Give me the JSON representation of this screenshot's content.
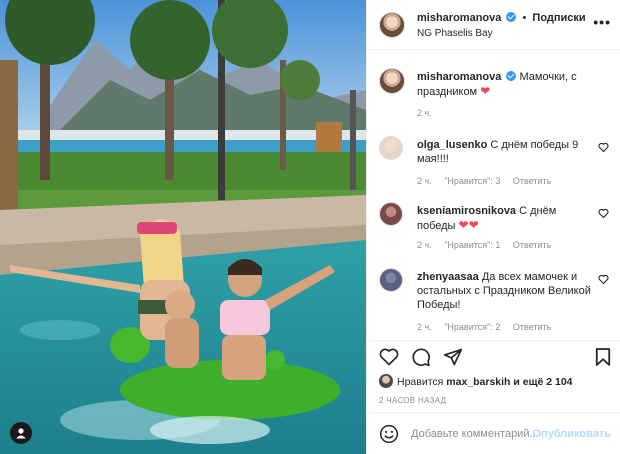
{
  "header": {
    "username": "misharomanova",
    "follow_label": "Подписки",
    "location": "NG Phaselis Bay",
    "more_label": "•••"
  },
  "caption": {
    "username": "misharomanova",
    "text": "Мамочки, с праздником",
    "time": "2 ч."
  },
  "comments": [
    {
      "username": "olga_lusenko",
      "text": "С днём победы 9 мая!!!!",
      "time": "2 ч.",
      "likes": "\"Нравится\": 3",
      "reply": "Ответить"
    },
    {
      "username": "kseniamirosnikova",
      "text": "С днём победы",
      "time": "2 ч.",
      "likes": "\"Нравится\": 1",
      "reply": "Ответить"
    },
    {
      "username": "zhenyaasaa",
      "text": "Да всех мамочек и остальных с Праздником Великой Победы!",
      "time": "2 ч.",
      "likes": "\"Нравится\": 2",
      "reply": "Ответить"
    }
  ],
  "likes": {
    "prefix": "Нравится",
    "user": "max_barskih",
    "rest": "и ещё 2 104"
  },
  "timestamp": "2 ЧАСОВ НАЗАД",
  "add_comment": {
    "placeholder": "Добавьте комментарий...",
    "post_label": "Опубликовать"
  },
  "colors": {
    "accent": "#3897f0",
    "heart": "#ed4956",
    "post_disabled": "#b3dbff"
  }
}
